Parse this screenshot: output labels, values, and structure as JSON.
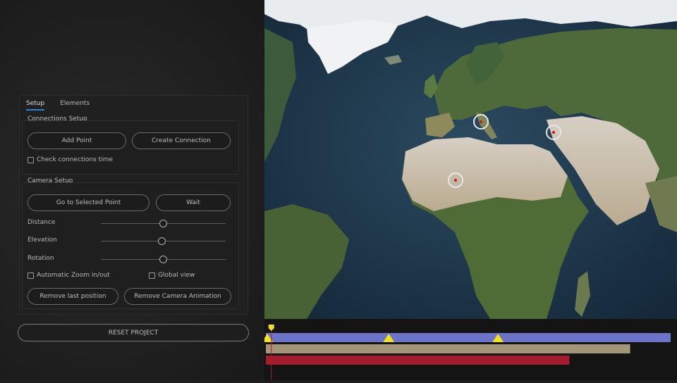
{
  "tabs": [
    {
      "label": "Setup",
      "active": true
    },
    {
      "label": "Elements",
      "active": false
    }
  ],
  "connections": {
    "title": "Connections Setup",
    "add_point": "Add Point",
    "create_connection": "Create Connection",
    "check_time": "Check connections time",
    "check_time_checked": false
  },
  "camera": {
    "title": "Camera Setup",
    "go_to_point": "Go to Selected Point",
    "wait": "Wait",
    "sliders": [
      {
        "label": "Distance",
        "value": 0.5
      },
      {
        "label": "Elevation",
        "value": 0.49
      },
      {
        "label": "Rotation",
        "value": 0.5
      }
    ],
    "auto_zoom": "Automatic Zoom in/out",
    "auto_zoom_checked": false,
    "global_view": "Global view",
    "global_view_checked": false,
    "remove_last": "Remove last position",
    "remove_anim": "Remove Camera Animation"
  },
  "reset": "RESET PROJECT",
  "colors": {
    "accent": "#2f7fd6",
    "track_blue": "#6b74c9",
    "track_tan": "#a3957a",
    "track_red": "#a51c2e",
    "keyframe": "#f2e21a",
    "point_marker": "#d01818"
  },
  "map_points": [
    "point-europe",
    "point-middle-east",
    "point-sahara"
  ],
  "timeline": {
    "playhead": 0.01,
    "keyframes": [
      0.0,
      0.3,
      0.57
    ],
    "tracks": [
      {
        "name": "track-camera",
        "start": 0.0,
        "end": 1.0
      },
      {
        "name": "track-connections",
        "start": 0.0,
        "end": 0.9
      },
      {
        "name": "track-points",
        "start": 0.0,
        "end": 0.75
      }
    ]
  }
}
